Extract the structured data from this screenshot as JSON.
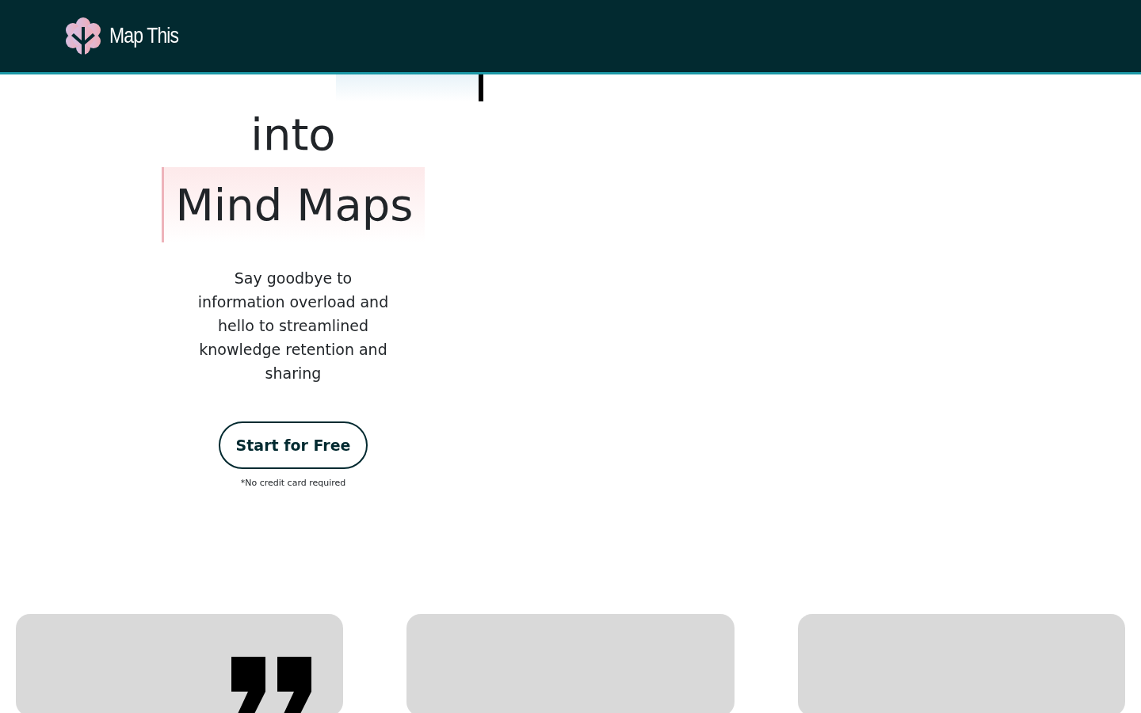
{
  "navbar": {
    "brand": "Map This"
  },
  "hero": {
    "typing_highlight": true,
    "headline": [
      {
        "parts": [
          {
            "text": "into",
            "kind": "plain"
          }
        ]
      },
      {
        "parts": [
          {
            "text": "Mind Maps",
            "kind": "marked"
          }
        ]
      }
    ],
    "subtitle": "Say goodbye to information overload and hello to streamlined knowledge retention and sharing",
    "cta": "Start for Free",
    "note": "*No credit card required"
  },
  "cards": [
    {
      "kind": "quote"
    },
    {
      "kind": "blank"
    },
    {
      "kind": "blank"
    }
  ]
}
